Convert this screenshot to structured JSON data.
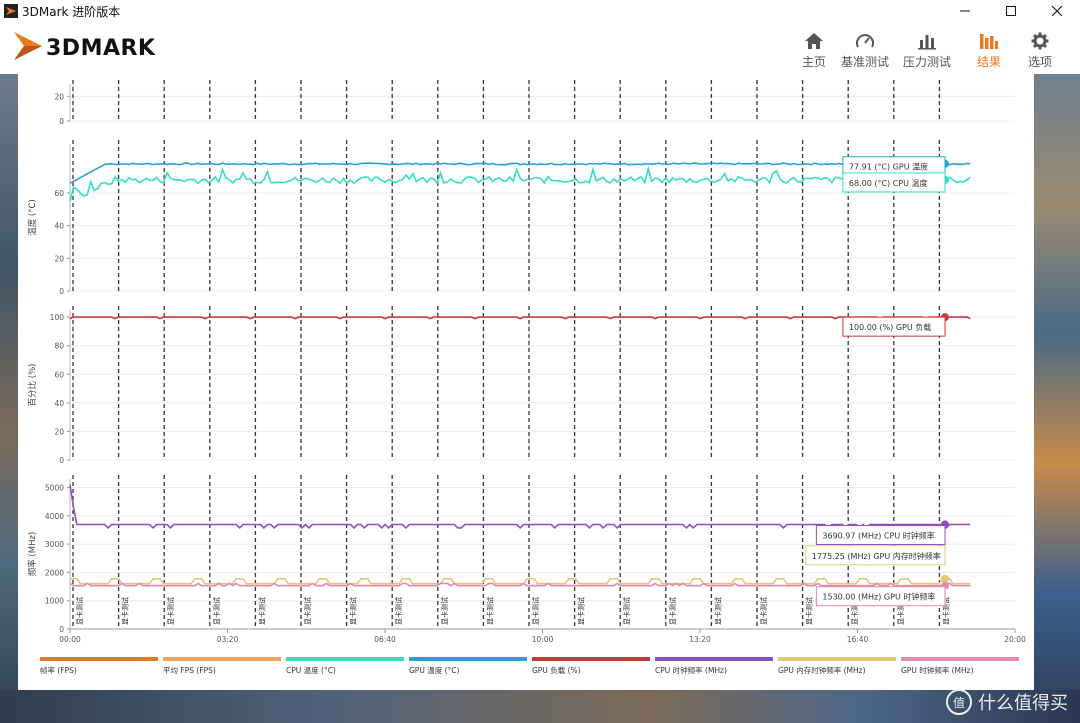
{
  "window": {
    "title": "3DMark 进阶版本"
  },
  "brand": {
    "logo_text": "3DMARK",
    "accent": "#e97a1f"
  },
  "nav": [
    {
      "key": "home",
      "label": "主页",
      "icon": "home-icon"
    },
    {
      "key": "benchmark",
      "label": "基准测试",
      "icon": "gauge-icon"
    },
    {
      "key": "stress",
      "label": "压力测试",
      "icon": "stress-bars-icon"
    },
    {
      "key": "results",
      "label": "结果",
      "icon": "results-bars-icon",
      "active": true
    },
    {
      "key": "options",
      "label": "选项",
      "icon": "gear-icon"
    }
  ],
  "watermark": {
    "symbol": "值",
    "text": "什么值得买"
  },
  "chart_data": {
    "type": "line",
    "x_ticks": [
      "00:00",
      "03:20",
      "06:40",
      "10:00",
      "13:20",
      "16:40",
      "20:00"
    ],
    "x_range_seconds": [
      0,
      1200
    ],
    "marker_label": "显卡测试",
    "panels": [
      {
        "id": "fps",
        "ylabel": "",
        "yticks": [
          0,
          20
        ],
        "ylim": [
          0,
          30
        ]
      },
      {
        "id": "temp",
        "ylabel": "温度 (°C)",
        "yticks": [
          0,
          20,
          40,
          60
        ],
        "ylim": [
          0,
          90
        ],
        "series": [
          {
            "name": "GPU 温度 (°C)",
            "color": "#2aa0d8",
            "annotation": "77.91 (°C) GPU 温度",
            "end_value": 77.91
          },
          {
            "name": "CPU 温度 (°C)",
            "color": "#33dfc0",
            "annotation": "68.00 (°C) CPU 温度",
            "end_value": 68.0
          }
        ]
      },
      {
        "id": "load",
        "ylabel": "百分比 (%)",
        "yticks": [
          0,
          20,
          40,
          60,
          80,
          100
        ],
        "ylim": [
          0,
          105
        ],
        "series": [
          {
            "name": "GPU 负载 (%)",
            "color": "#c73a3a",
            "annotation": "100.00 (%) GPU 负载",
            "end_value": 100.0
          }
        ]
      },
      {
        "id": "freq",
        "ylabel": "频率 (MHz)",
        "yticks": [
          0,
          1000,
          2000,
          3000,
          4000,
          5000
        ],
        "ylim": [
          0,
          5300
        ],
        "series": [
          {
            "name": "CPU 时钟频率 (MHz)",
            "color": "#8e4fc0",
            "annotation": "3690.97 (MHz) CPU 时钟频率",
            "end_value": 3690.97
          },
          {
            "name": "GPU 内存时钟频率 (MHz)",
            "color": "#e3c777",
            "annotation": "1775.25 (MHz) GPU 内存时钟频率",
            "end_value": 1775.25
          },
          {
            "name": "GPU 时钟频率 (MHz)",
            "color": "#e28ab0",
            "annotation": "1530.00 (MHz) GPU 时钟频率",
            "end_value": 1530.0
          }
        ]
      }
    ],
    "legend": [
      {
        "name": "帧率 (FPS)",
        "color": "#e07a2a"
      },
      {
        "name": "平均 FPS (FPS)",
        "color": "#f0a35c"
      },
      {
        "name": "CPU 温度 (°C)",
        "color": "#33dfc0"
      },
      {
        "name": "GPU 温度 (°C)",
        "color": "#2aa0d8"
      },
      {
        "name": "GPU 负载 (%)",
        "color": "#c73a3a"
      },
      {
        "name": "CPU 时钟频率 (MHz)",
        "color": "#8e4fc0"
      },
      {
        "name": "GPU 内存时钟频率 (MHz)",
        "color": "#e3c777"
      },
      {
        "name": "GPU 时钟频率 (MHz)",
        "color": "#e28ab0"
      }
    ]
  }
}
